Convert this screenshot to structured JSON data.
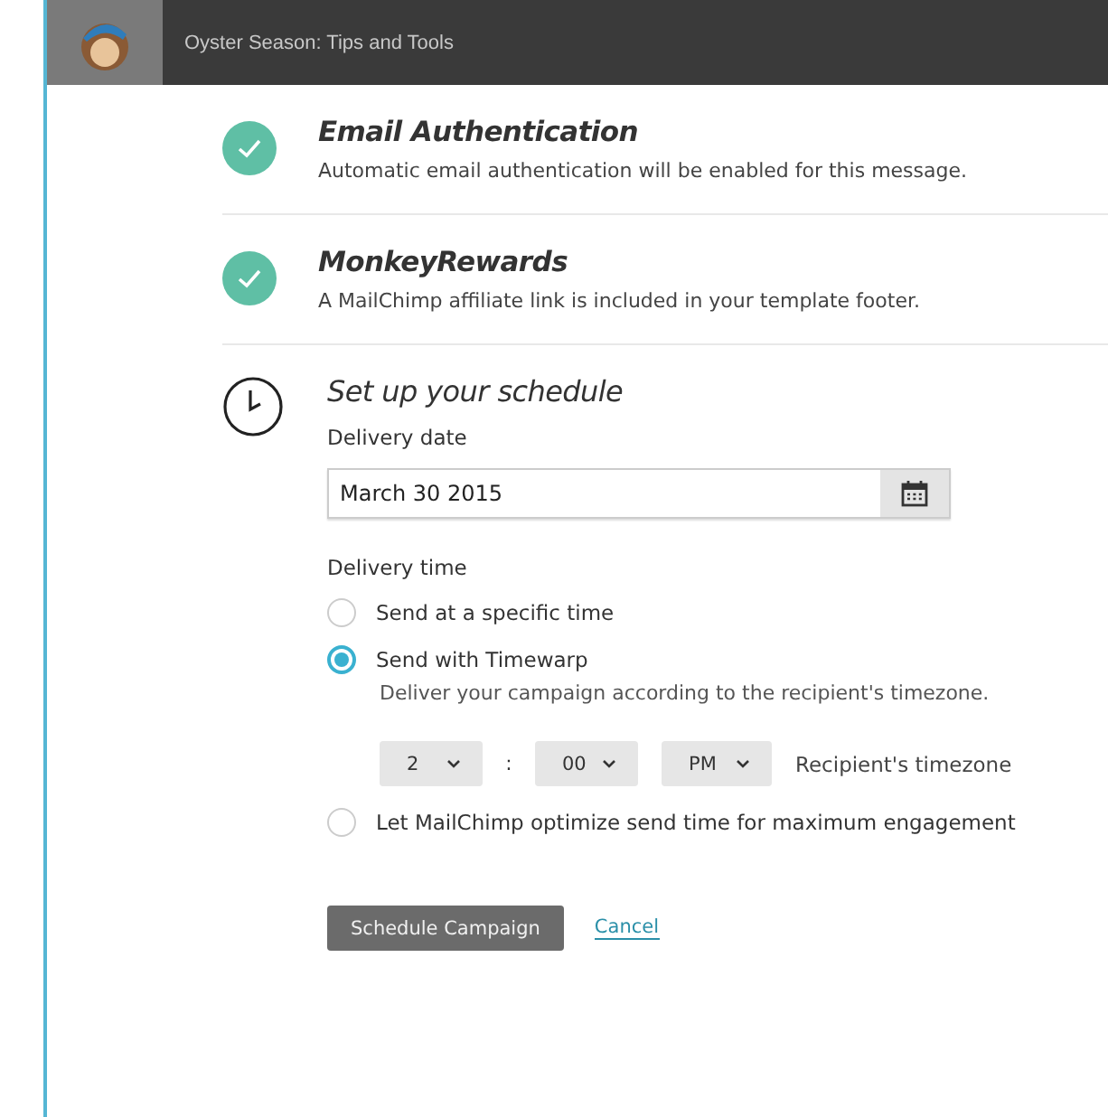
{
  "header": {
    "title": "Oyster Season: Tips and Tools"
  },
  "checklist": [
    {
      "title": "Email Authentication",
      "description": "Automatic email authentication will be enabled for this message.",
      "complete": true
    },
    {
      "title": "MonkeyRewards",
      "description": "A MailChimp affiliate link is included in your template footer.",
      "complete": true
    }
  ],
  "schedule": {
    "title": "Set up your schedule",
    "date_label": "Delivery date",
    "date_value": "March 30 2015",
    "time_label": "Delivery time",
    "options": [
      {
        "label": "Send at a specific time",
        "selected": false
      },
      {
        "label": "Send with Timewarp",
        "selected": true,
        "description": "Deliver your campaign according to the recipient's timezone.",
        "time": {
          "hour": "2",
          "separator": ":",
          "minute": "00",
          "period": "PM",
          "timezone": "Recipient's timezone"
        }
      },
      {
        "label": "Let MailChimp optimize send time for maximum engagement",
        "selected": false
      }
    ],
    "buttons": {
      "primary": "Schedule Campaign",
      "cancel": "Cancel"
    }
  }
}
